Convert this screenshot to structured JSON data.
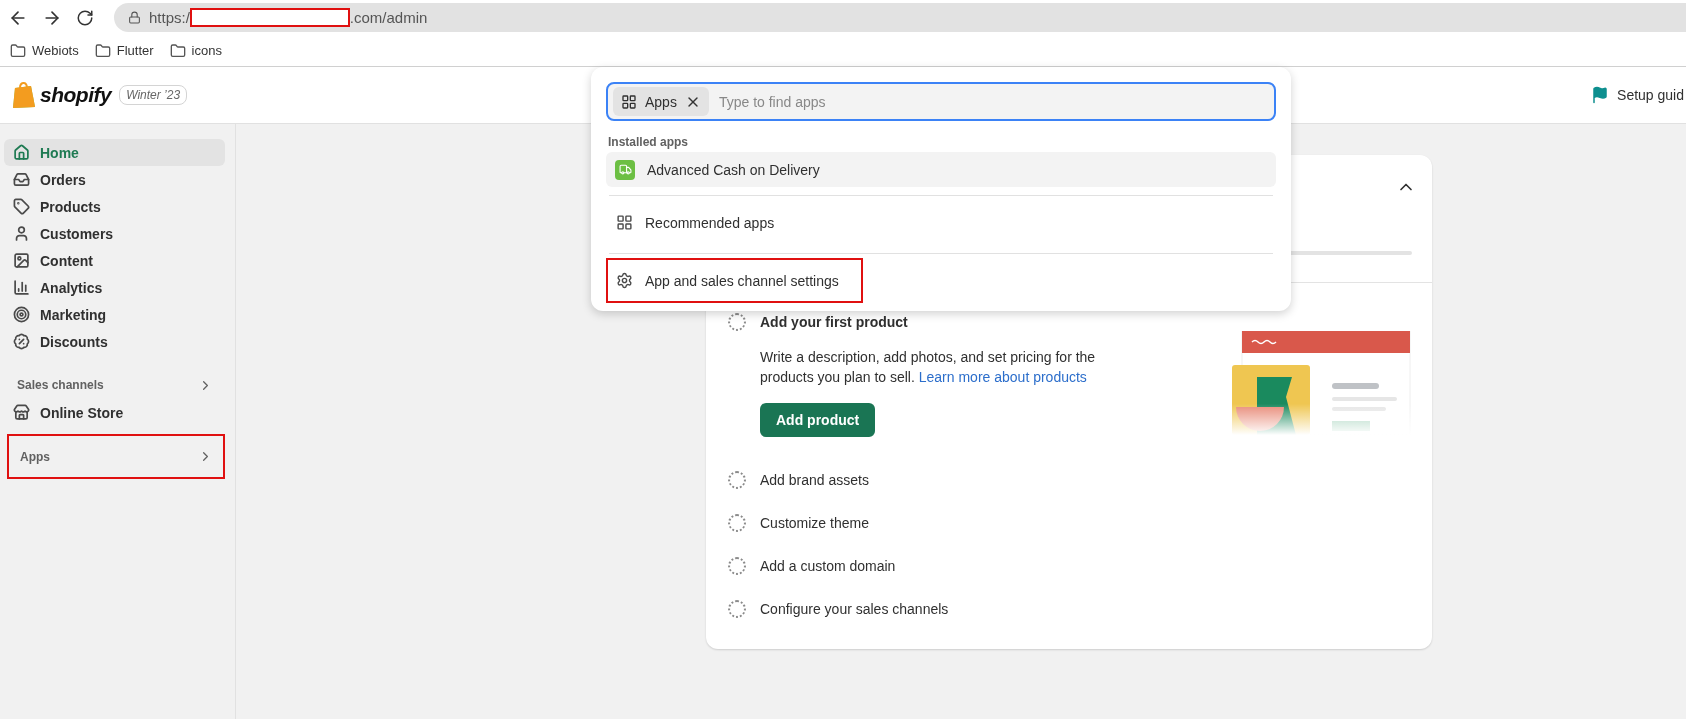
{
  "browser": {
    "url_start": "https:/",
    "url_end": ".com/admin",
    "bookmarks": [
      "Webiots",
      "Flutter",
      "icons"
    ]
  },
  "topbar": {
    "logo": "shopify",
    "edition": "Winter ’23",
    "setup_guide": "Setup guid"
  },
  "sidebar": {
    "items": [
      {
        "label": "Home",
        "selected": true
      },
      {
        "label": "Orders",
        "selected": false
      },
      {
        "label": "Products",
        "selected": false
      },
      {
        "label": "Customers",
        "selected": false
      },
      {
        "label": "Content",
        "selected": false
      },
      {
        "label": "Analytics",
        "selected": false
      },
      {
        "label": "Marketing",
        "selected": false
      },
      {
        "label": "Discounts",
        "selected": false
      }
    ],
    "sales_channels": {
      "title": "Sales channels",
      "highlighted": false,
      "items": [
        {
          "label": "Online Store",
          "selected": false
        }
      ]
    },
    "apps": {
      "title": "Apps",
      "highlighted": true
    }
  },
  "app_search": {
    "chip": "Apps",
    "placeholder": "Type to find apps",
    "section_title": "Installed apps",
    "installed": [
      {
        "label": "Advanced Cash on Delivery",
        "selected": true
      }
    ],
    "actions": [
      {
        "label": "Recommended apps",
        "highlighted": false
      },
      {
        "label": "App and sales channel settings",
        "highlighted": true
      }
    ]
  },
  "setup_card": {
    "expanded": true,
    "tasks": [
      {
        "label": "Add your first product",
        "expanded": true,
        "description": "Write a description, add photos, and set pricing for the products you plan to sell.",
        "link": "Learn more about products",
        "button": "Add product"
      },
      {
        "label": "Add brand assets",
        "expanded": false
      },
      {
        "label": "Customize theme",
        "expanded": false
      },
      {
        "label": "Add a custom domain",
        "expanded": false
      },
      {
        "label": "Configure your sales channels",
        "expanded": false
      }
    ]
  }
}
